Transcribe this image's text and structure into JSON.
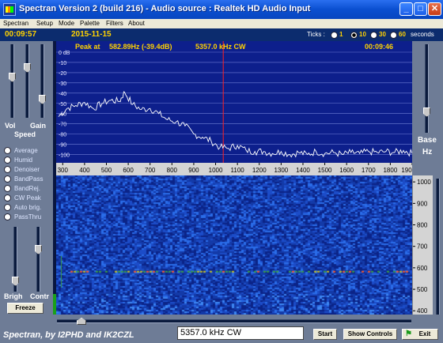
{
  "window": {
    "title": "Spectran Version 2 (build 216) - Audio source  :  Realtek HD Audio Input"
  },
  "menu": [
    "Spectran",
    "Setup",
    "Mode",
    "Palette",
    "Filters",
    "About"
  ],
  "header": {
    "elapsed": "00:09:57",
    "date": "2015-11-15",
    "ticks_label": "Ticks :",
    "ticks_options": [
      "1",
      "10",
      "30",
      "60"
    ],
    "ticks_selected": "10",
    "ticks_unit": "seconds"
  },
  "peak": {
    "label": "Peak at",
    "value": "582.89Hz (-39.4dB)",
    "freq": "5357.0 kHz CW",
    "time": "00:09:46"
  },
  "left_panel": {
    "vol_label": "Vol",
    "gain_label": "Gain",
    "speed_label": "Speed",
    "modes": [
      "Average",
      "Humid",
      "Denoiser",
      "BandPass",
      "BandRej.",
      "CW Peak",
      "Auto brig.",
      "PassThru"
    ],
    "brig_label": "Brigh",
    "contr_label": "Contr",
    "freeze_label": "Freeze"
  },
  "right_panel": {
    "base_label": "Base",
    "unit_label": "Hz"
  },
  "chart_data": {
    "type": "line",
    "ylabel": "dB",
    "y_ticks": [
      "0 dB",
      "-10",
      "-20",
      "-30",
      "-40",
      "-50",
      "-60",
      "-70",
      "-80",
      "-90",
      "-100"
    ],
    "ylim": [
      -105,
      0
    ],
    "x_ticks": [
      "300",
      "400",
      "500",
      "600",
      "700",
      "800",
      "900",
      "1000",
      "1100",
      "1200",
      "1300",
      "1400",
      "1500",
      "1600",
      "1700",
      "1800",
      "190"
    ],
    "xlim": [
      270,
      1900
    ],
    "marker_hz": 1035,
    "series": [
      {
        "x": [
          280,
          320,
          360,
          400,
          440,
          480,
          520,
          560,
          583,
          620,
          660,
          700,
          740,
          780,
          820,
          860,
          900,
          940,
          980,
          1020,
          1060,
          1100,
          1140,
          1180,
          1220,
          1260,
          1300,
          1340,
          1380,
          1420,
          1460,
          1500,
          1540,
          1580,
          1620,
          1660,
          1700,
          1740,
          1780,
          1820,
          1860,
          1900
        ],
        "values": [
          -63,
          -55,
          -52,
          -49,
          -55,
          -50,
          -47,
          -48,
          -39,
          -51,
          -56,
          -55,
          -60,
          -66,
          -68,
          -72,
          -80,
          -83,
          -87,
          -93,
          -94,
          -91,
          -96,
          -97,
          -97,
          -99,
          -97,
          -100,
          -98,
          -100,
          -97,
          -99,
          -98,
          -100,
          -98,
          -99,
          -97,
          -98,
          -97,
          -98,
          -96,
          -99
        ]
      }
    ]
  },
  "waterfall": {
    "y_ticks": [
      "1000",
      "900",
      "800",
      "700",
      "600",
      "500",
      "400",
      "300"
    ],
    "signal_hz": 582
  },
  "footer": {
    "credits": "Spectran, by I2PHD and IK2CZL",
    "freq_field": "5357.0 kHz CW",
    "start_label": "Start",
    "show_controls_label": "Show Controls",
    "exit_label": "Exit"
  }
}
